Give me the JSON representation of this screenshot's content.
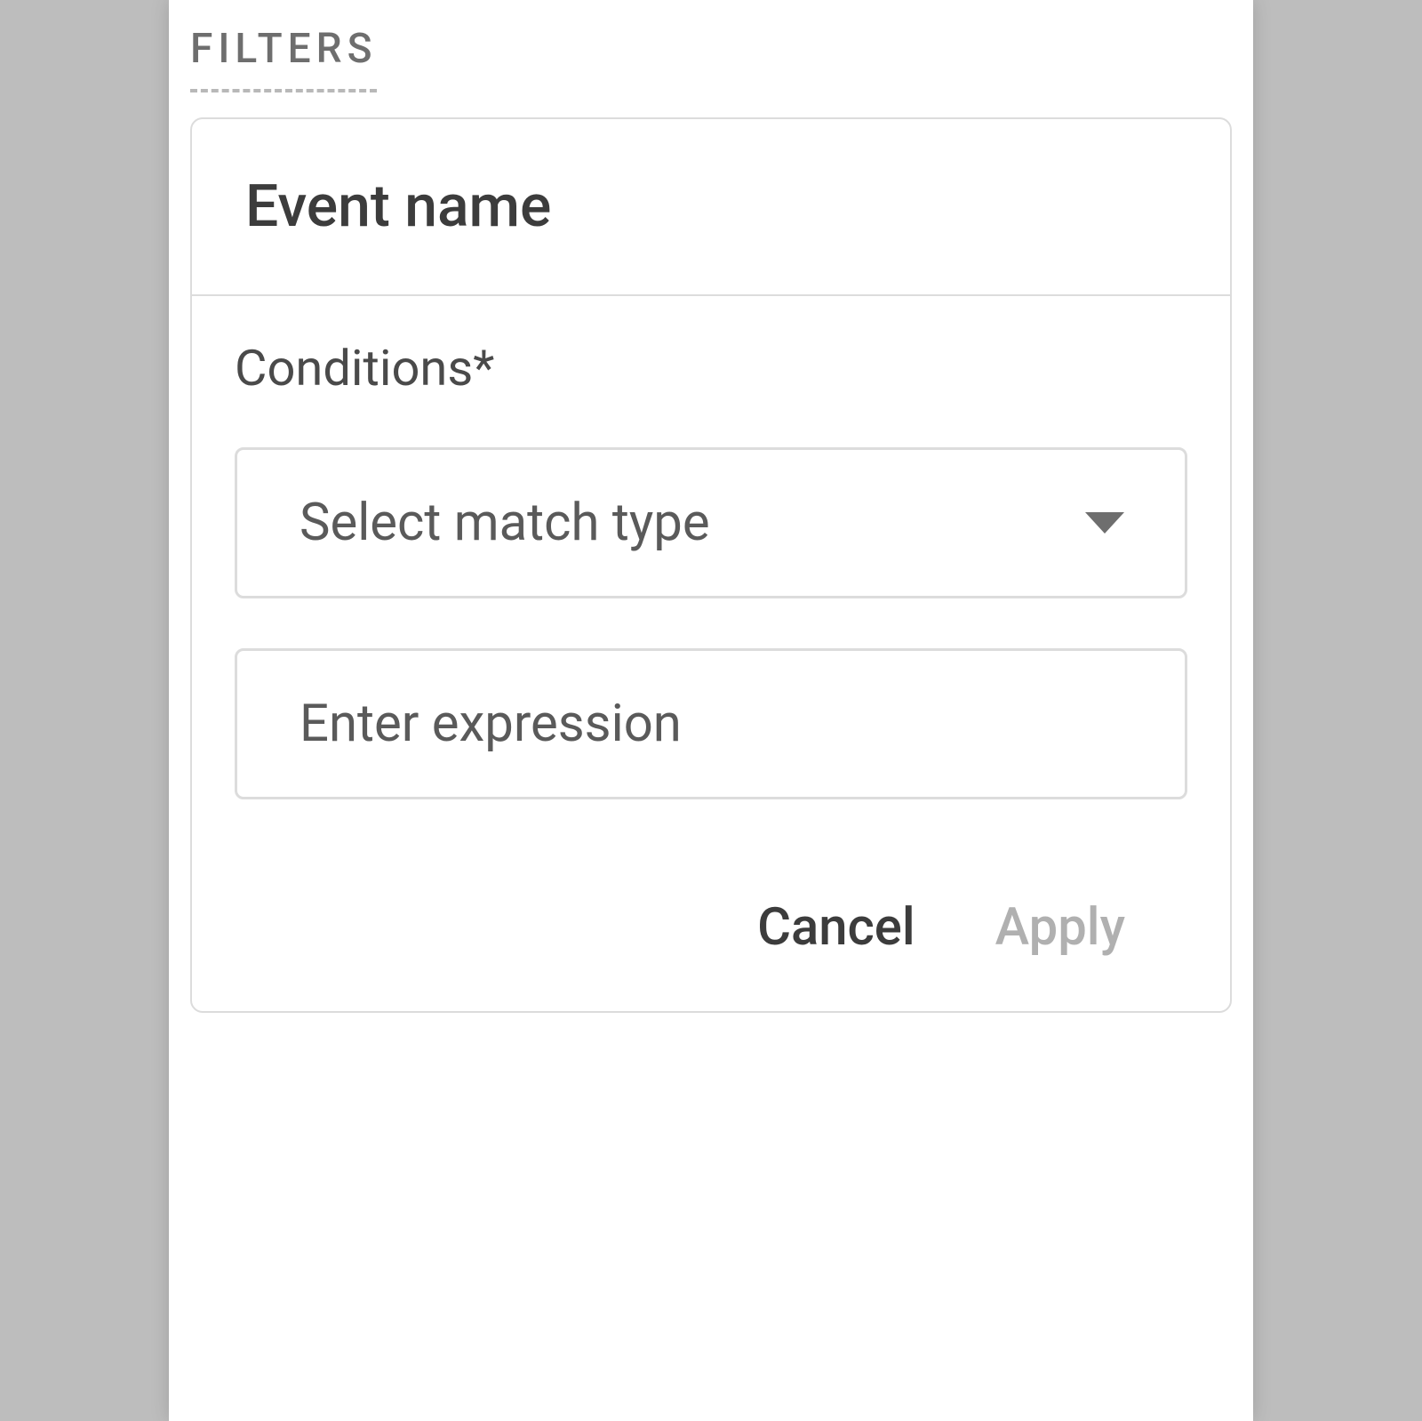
{
  "section_title": "FILTERS",
  "card": {
    "header_title": "Event name",
    "conditions_label": "Conditions*",
    "match_type_select": {
      "placeholder": "Select match type"
    },
    "expression_input": {
      "placeholder": "Enter expression",
      "value": ""
    },
    "buttons": {
      "cancel": "Cancel",
      "apply": "Apply"
    }
  }
}
